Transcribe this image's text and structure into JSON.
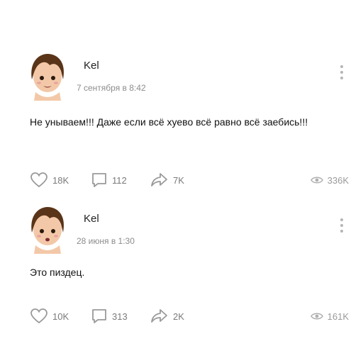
{
  "posts": [
    {
      "author": "Kel",
      "date": "7 сентября в 8:42",
      "text": "Не унываем!!! Даже если всё хуево всё равно всё заебись!!!",
      "likes": "18K",
      "comments": "112",
      "shares": "7K",
      "views": "336K"
    },
    {
      "author": "Kel",
      "date": "28 июня в 1:30",
      "text": "Это пиздец.",
      "likes": "10K",
      "comments": "313",
      "shares": "2K",
      "views": "161K"
    }
  ],
  "icons": {
    "like": "heart-icon",
    "comment": "comment-icon",
    "share": "share-icon",
    "views": "eye-icon",
    "menu": "more-vertical-icon"
  },
  "colors": {
    "text": "#111111",
    "meta": "#8c8c8c",
    "icon": "#9a9a9a"
  }
}
